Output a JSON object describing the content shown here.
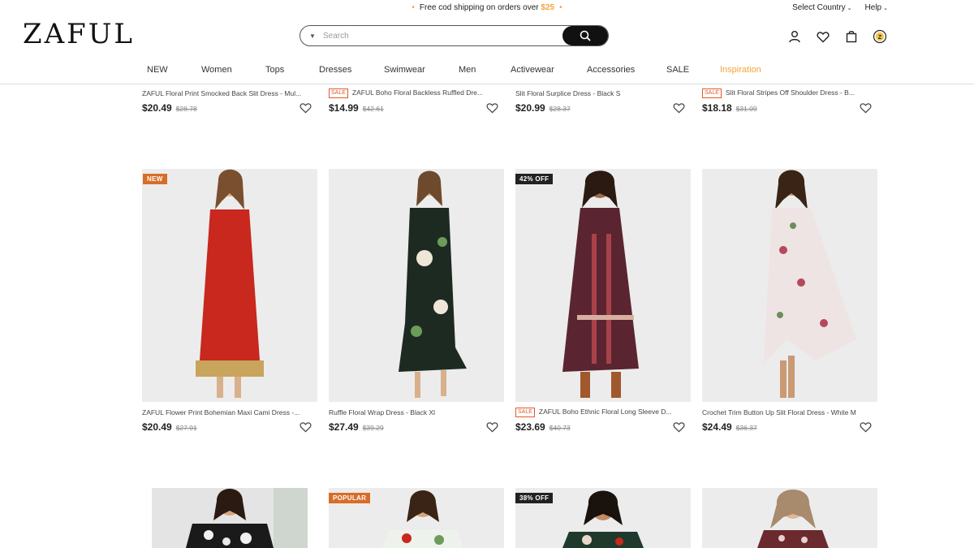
{
  "promo": {
    "text": "Free cod shipping on orders over",
    "amount": "$25"
  },
  "top_links": {
    "country": "Select Country",
    "help": "Help"
  },
  "logo": "ZAFUL",
  "search": {
    "placeholder": "Search"
  },
  "nav": [
    "NEW",
    "Women",
    "Tops",
    "Dresses",
    "Swimwear",
    "Men",
    "Activewear",
    "Accessories",
    "SALE",
    "Inspiration"
  ],
  "row1": [
    {
      "title": "ZAFUL Floral Print Smocked Back Slit Dress - Mul...",
      "sale": "",
      "price": "$20.49",
      "old": "$28.78"
    },
    {
      "title": "ZAFUL Boho Floral Backless Ruffled Dre...",
      "sale": "SALE",
      "price": "$14.99",
      "old": "$42.61"
    },
    {
      "title": "Slit Floral Surplice Dress - Black S",
      "sale": "",
      "price": "$20.99",
      "old": "$28.37"
    },
    {
      "title": "Slit Floral Stripes Off Shoulder Dress - B...",
      "sale": "SALE",
      "price": "$18.18",
      "old": "$31.09"
    }
  ],
  "row2": [
    {
      "badge": "NEW",
      "title": "ZAFUL Flower Print Bohemian Maxi Cami Dress -...",
      "sale": "",
      "price": "$20.49",
      "old": "$27.91",
      "dress_color": "#c8281e"
    },
    {
      "badge": "",
      "title": "Ruffle Floral Wrap Dress - Black Xl",
      "sale": "",
      "price": "$27.49",
      "old": "$39.29",
      "dress_color": "#1d2a22"
    },
    {
      "badge": "42% OFF",
      "title": "ZAFUL Boho Ethnic Floral Long Sleeve D...",
      "sale": "SALE",
      "price": "$23.69",
      "old": "$40.73",
      "dress_color": "#5a2530"
    },
    {
      "badge": "",
      "title": "Crochet Trim Button Up Slit Floral Dress - White M",
      "sale": "",
      "price": "$24.49",
      "old": "$36.37",
      "dress_color": "#efe4e4"
    }
  ],
  "row3": [
    {
      "badge": "",
      "dress_color": "#1a1a1a"
    },
    {
      "badge": "POPULAR",
      "dress_color": "#eef2ec"
    },
    {
      "badge": "38% OFF",
      "dress_color": "#1f3a2c"
    },
    {
      "badge": "",
      "dress_color": "#6b2a2e"
    }
  ],
  "colors": {
    "accent": "#f3a43a",
    "sale": "#e05b2b",
    "badge_orange": "#d86d28"
  },
  "icons": [
    "user-icon",
    "heart-icon",
    "bag-icon",
    "zaful-coin-icon",
    "search-icon"
  ]
}
